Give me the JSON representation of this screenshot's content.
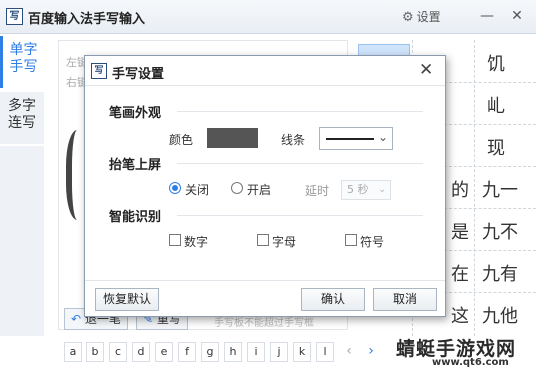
{
  "window": {
    "title": "百度输入法手写输入",
    "icon_letter": "写",
    "settings_label": "设置",
    "settings_icon": "gear-icon",
    "minimize_label": "—",
    "close_label": "✕"
  },
  "tabs": [
    {
      "line1": "单字",
      "line2": "手写",
      "active": true
    },
    {
      "line1": "多字",
      "line2": "连写",
      "active": false
    }
  ],
  "pad": {
    "hint1": "左键",
    "hint2": "右键",
    "undo_label": "退一笔",
    "rewrite_label": "重写",
    "footer_hint": "手写板不能超过手写框"
  },
  "candidates": [
    [
      "",
      "饥"
    ],
    [
      "",
      "乢"
    ],
    [
      "",
      "现"
    ],
    [
      "的",
      "九一"
    ],
    [
      "是",
      "九不"
    ],
    [
      "在",
      "九有"
    ],
    [
      "这",
      "九他"
    ]
  ],
  "letters": [
    "a",
    "b",
    "c",
    "d",
    "e",
    "f",
    "g",
    "h",
    "i",
    "j",
    "k",
    "l"
  ],
  "nav": {
    "prev": "‹",
    "next": "›"
  },
  "watermark": {
    "text": "蜻蜓手游戏网",
    "url": "www.qt6.com"
  },
  "dialog": {
    "icon_letter": "写",
    "title": "手写设置",
    "close_label": "✕",
    "stroke_section": "笔画外观",
    "color_label": "颜色",
    "color_value": "#555555",
    "line_label": "线条",
    "lift_section": "抬笔上屏",
    "off_label": "关闭",
    "on_label": "开启",
    "delay_label": "延时",
    "delay_value": "5 秒",
    "smart_section": "智能识别",
    "digit_label": "数字",
    "letter_label": "字母",
    "symbol_label": "符号",
    "reset_button": "恢复默认",
    "ok_button": "确认",
    "cancel_button": "取消",
    "lift_selected": "off"
  },
  "colors": {
    "accent": "#2f7ee6",
    "dialog_border": "#8a9bb0"
  }
}
